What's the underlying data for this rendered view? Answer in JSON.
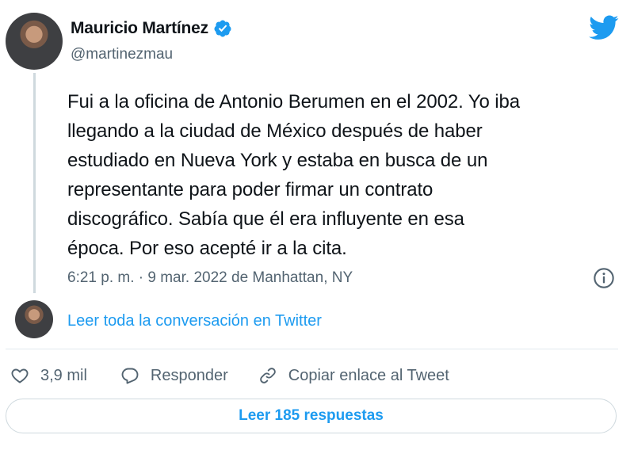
{
  "author": {
    "name": "Mauricio Martínez",
    "handle": "@martinezmau"
  },
  "tweet": {
    "text": "Fui a la oficina de Antonio Berumen en el 2002. Yo iba\nllegando a la ciudad de México después de haber\nestudiado en Nueva York y estaba en busca de un\nrepresentante para poder firmar un contrato\ndiscográfico. Sabía que él era influyente en esa\népoca. Por eso acepté ir a la cita.",
    "timestamp": "6:21 p. m. · 9 mar. 2022 de Manhattan, NY"
  },
  "thread": {
    "read_conversation": "Leer toda la conversación en Twitter"
  },
  "actions": {
    "likes": "3,9 mil",
    "reply": "Responder",
    "copy_link": "Copiar enlace al Tweet"
  },
  "replies_button": "Leer 185 respuestas",
  "colors": {
    "accent": "#1d9bf0",
    "secondary_text": "#536471",
    "primary_text": "#0f1419"
  },
  "icons": [
    "verified-badge-icon",
    "twitter-bird-icon",
    "info-icon",
    "heart-icon",
    "reply-bubble-icon",
    "link-icon"
  ]
}
